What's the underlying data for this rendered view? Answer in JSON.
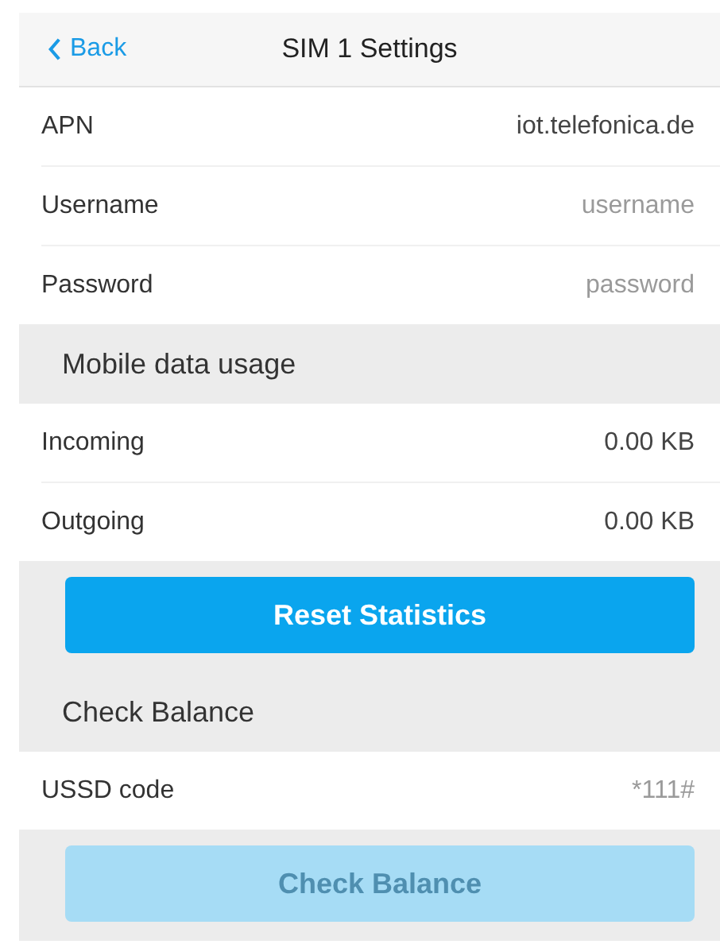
{
  "header": {
    "back": "Back",
    "title": "SIM 1 Settings"
  },
  "sections": [
    {
      "rows": [
        {
          "kind": "value",
          "label": "APN",
          "value": "iot.telefonica.de"
        },
        {
          "kind": "input",
          "label": "Username",
          "placeholder": "username"
        },
        {
          "kind": "input",
          "label": "Password",
          "placeholder": "password"
        }
      ]
    },
    {
      "title": "Mobile data usage",
      "rows": [
        {
          "kind": "value",
          "label": "Incoming",
          "value": "0.00 KB"
        },
        {
          "kind": "value",
          "label": "Outgoing",
          "value": "0.00 KB"
        }
      ],
      "button": {
        "label": "Reset Statistics",
        "disabled": false
      }
    },
    {
      "title": "Check Balance",
      "rows": [
        {
          "kind": "input",
          "label": "USSD code",
          "placeholder": "*111#"
        }
      ],
      "button": {
        "label": "Check Balance",
        "disabled": true
      }
    }
  ]
}
